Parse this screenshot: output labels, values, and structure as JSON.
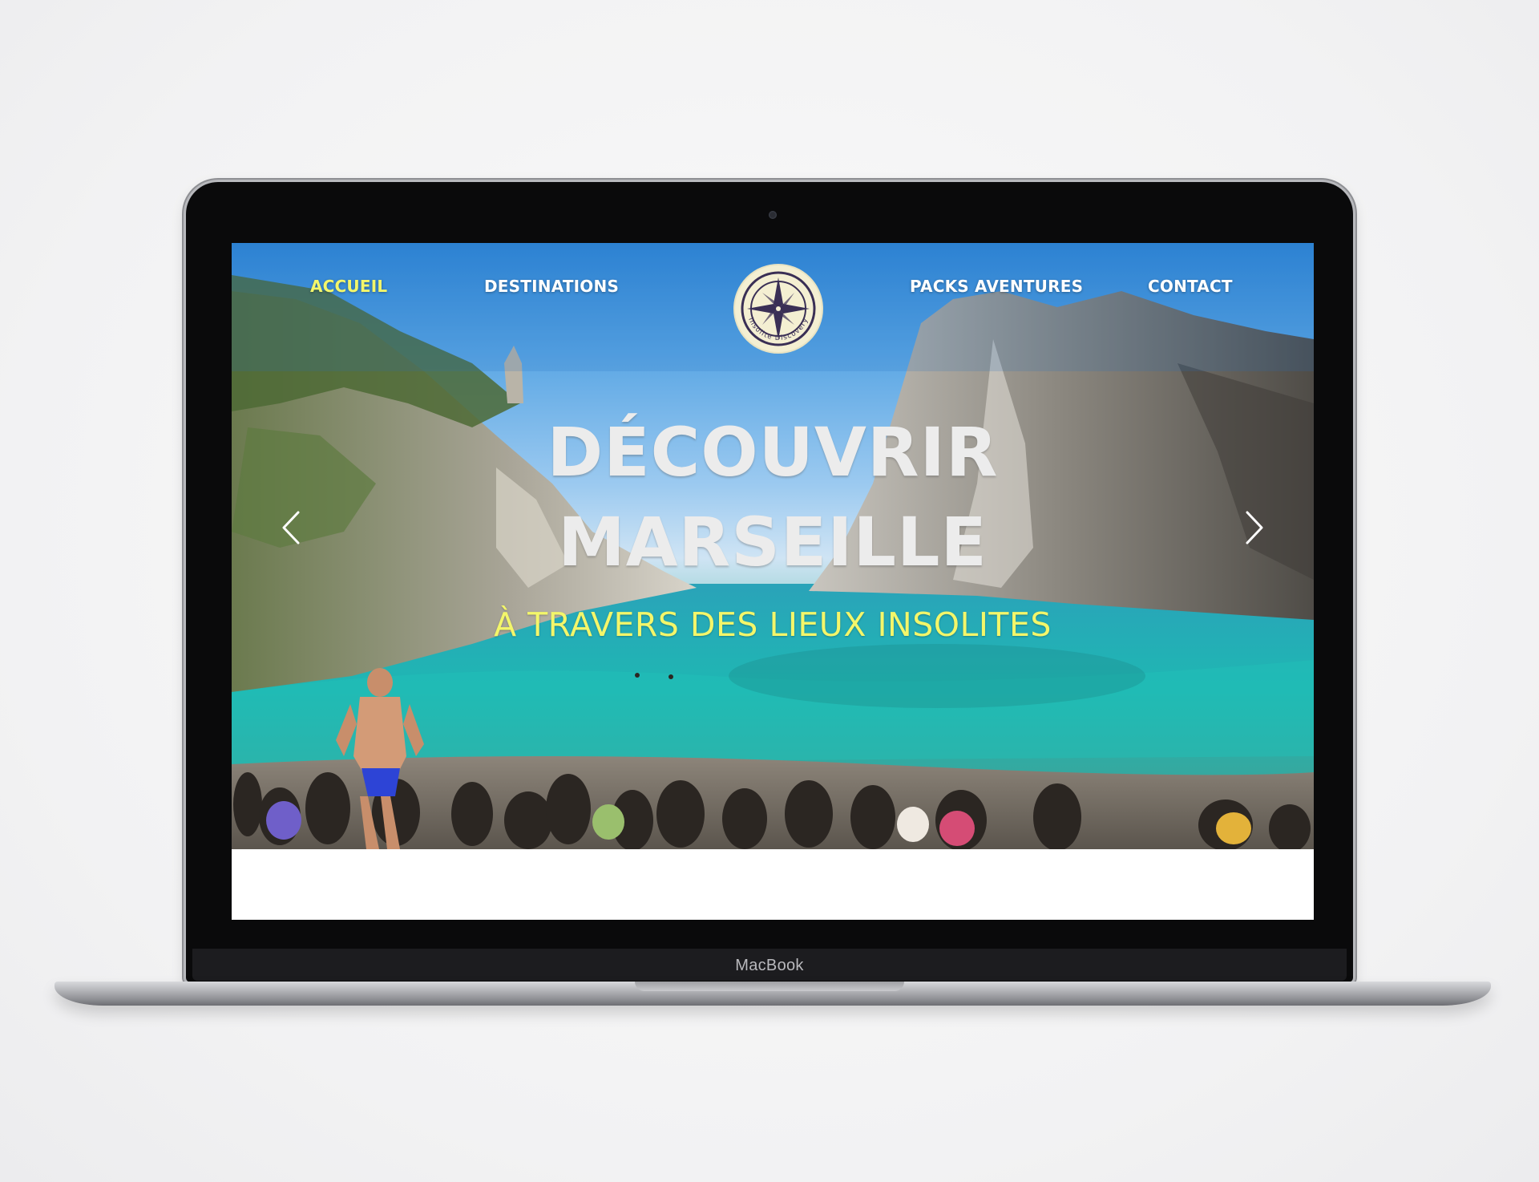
{
  "device": {
    "brand_label": "MacBook"
  },
  "nav": {
    "items": [
      {
        "label": "ACCUEIL",
        "active": true
      },
      {
        "label": "DESTINATIONS",
        "active": false
      },
      {
        "label": "PACKS AVENTURES",
        "active": false
      },
      {
        "label": "CONTACT",
        "active": false
      }
    ]
  },
  "logo": {
    "text": "Insolite Discovery",
    "icon": "compass-rose-icon"
  },
  "hero": {
    "headline_line1": "DÉCOUVRIR",
    "headline_line2": "MARSEILLE",
    "subtitle": "À TRAVERS DES LIEUX INSOLITES",
    "prev_icon": "chevron-left-icon",
    "next_icon": "chevron-right-icon"
  },
  "colors": {
    "accent_yellow": "#f3f66a",
    "logo_navy": "#3a2f55",
    "logo_cream": "#f4efd2",
    "headline_silver": "#ececec"
  }
}
